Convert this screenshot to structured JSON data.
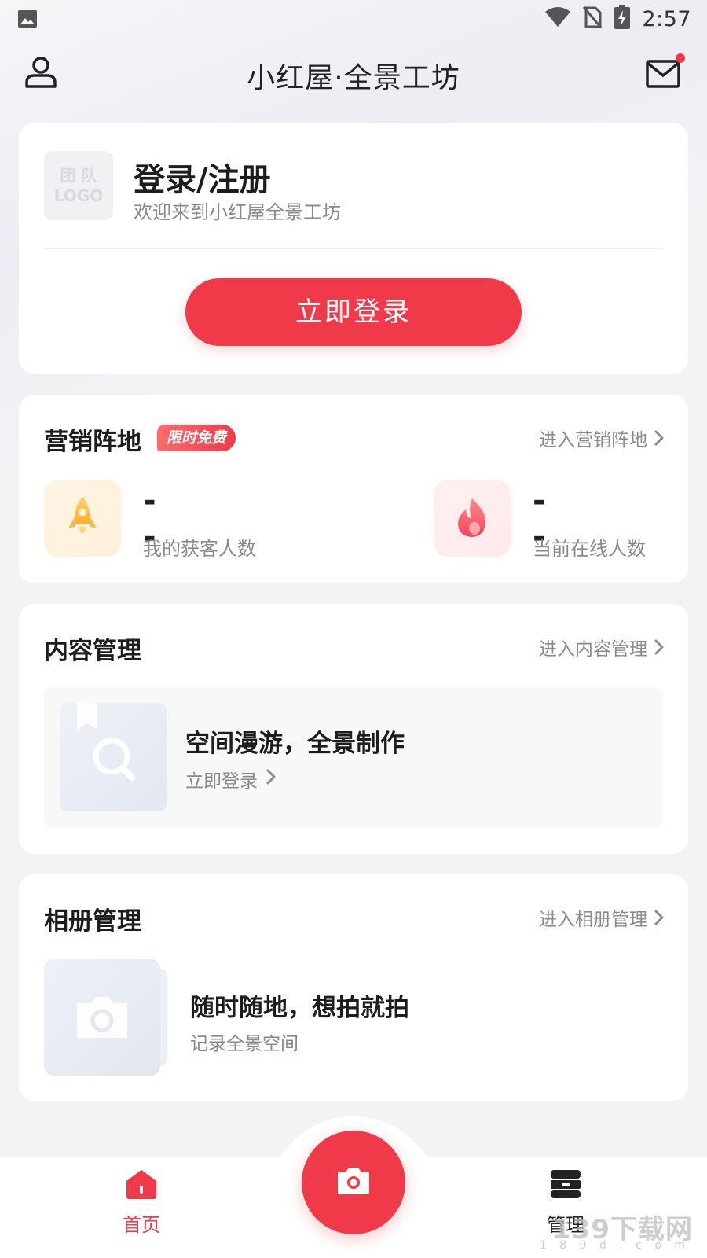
{
  "status_bar": {
    "time": "2:57",
    "icons": [
      "image-icon",
      "wifi-icon",
      "no-sim-icon",
      "battery-charging-icon"
    ]
  },
  "header": {
    "title": "小红屋·全景工坊",
    "icons": [
      "user-icon",
      "mail-icon"
    ]
  },
  "login_card": {
    "logo_line1": "团 队",
    "logo_line2": "LOGO",
    "title": "登录/注册",
    "subtitle": "欢迎来到小红屋全景工坊",
    "button": "立即登录"
  },
  "marketing": {
    "title": "营销阵地",
    "badge": "限时免费",
    "link": "进入营销阵地",
    "stats": [
      {
        "value": "--",
        "label": "我的获客人数",
        "icon": "rocket-icon"
      },
      {
        "value": "--",
        "label": "当前在线人数",
        "icon": "fire-icon"
      }
    ]
  },
  "content_mgmt": {
    "title": "内容管理",
    "link": "进入内容管理",
    "item_title": "空间漫游，全景制作",
    "item_action": "立即登录"
  },
  "album_mgmt": {
    "title": "相册管理",
    "link": "进入相册管理",
    "item_title": "随时随地，想拍就拍",
    "item_sub": "记录全景空间"
  },
  "tabbar": {
    "home": "首页",
    "manage": "管理"
  },
  "watermark": {
    "text": "139下载网",
    "sub": "1 8 9 d . c o m"
  },
  "colors": {
    "accent": "#f03a4a",
    "text_primary": "#1d1d1d",
    "text_secondary": "#888888"
  }
}
